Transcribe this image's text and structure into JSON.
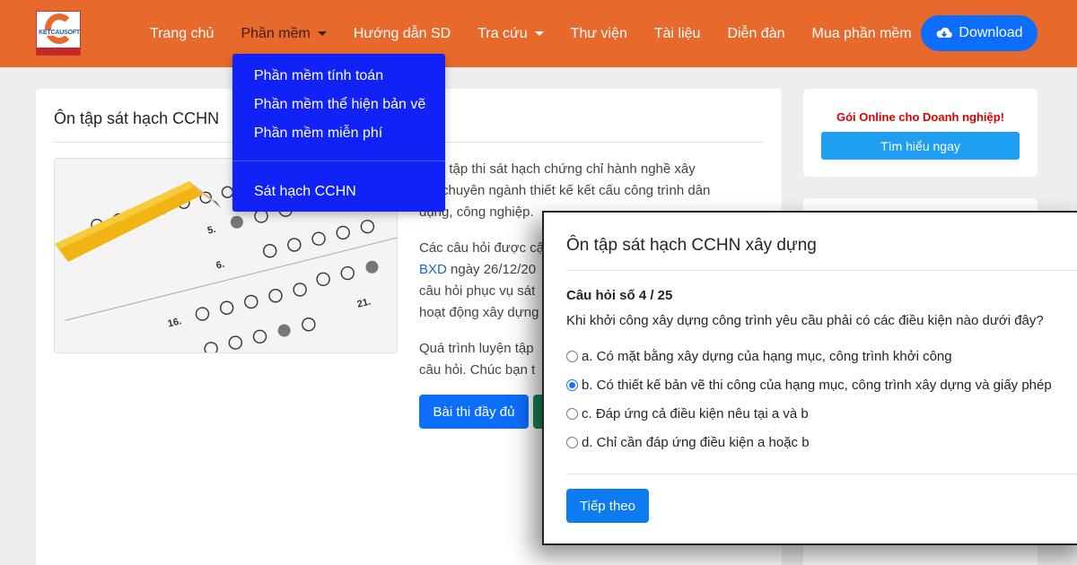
{
  "navbar": {
    "logo_text": "KETCAUSOFT",
    "items": [
      {
        "label": "Trang chủ"
      },
      {
        "label": "Phần mềm"
      },
      {
        "label": "Hướng dẫn SD"
      },
      {
        "label": "Tra cứu"
      },
      {
        "label": "Thư viện"
      },
      {
        "label": "Tài liệu"
      },
      {
        "label": "Diễn đàn"
      },
      {
        "label": "Mua phần mềm"
      }
    ],
    "download_label": "Download"
  },
  "dropdown": {
    "items": [
      {
        "label": "Phần mềm tính toán"
      },
      {
        "label": "Phần mềm thể hiện bản vẽ"
      },
      {
        "label": "Phần mềm miễn phí"
      },
      {
        "label": "Sát hạch CCHN"
      }
    ]
  },
  "main": {
    "title": "Ôn tập sát hạch CCHN",
    "para1": "g ôn tập thi sát hạch chứng chỉ hành nghề xây\nng, chuyên ngành thiết kế kết cấu công trình dân\ndụng, công nghiệp.",
    "para2_pre": "Các câu hỏi được cậ",
    "para2_link": "BXD",
    "para2_post": " ngày 26/12/20",
    "para2_rest": "câu hỏi phục vụ sát\nhoạt động xây dựng",
    "para3": "Quá trình luyện tập\ncâu hỏi. Chúc bạn t",
    "btn_full": "Bài thi đầy đủ"
  },
  "sidebar": {
    "promo_text": "Gói Online cho Doanh nghiệp!",
    "promo_button": "Tìm hiểu ngay"
  },
  "modal": {
    "title": "Ôn tập sát hạch CCHN xây dựng",
    "question_no": "Câu hỏi số 4 / 25",
    "question": "Khi khởi công xây dựng công trình yêu cầu phải có các điều kiện nào dưới đây?",
    "options": [
      {
        "label": "a. Có mặt bằng xây dựng của hạng mục, công trình khởi công",
        "checked": false
      },
      {
        "label": "b. Có thiết kế bản vẽ thi công của hạng mục, công trình xây dựng và giấy phép",
        "checked": true
      },
      {
        "label": "c. Đáp ứng cả điều kiện nêu tại a và b",
        "checked": false
      },
      {
        "label": "d. Chỉ cần đáp ứng điều kiện a hoặc b",
        "checked": false
      }
    ],
    "next_label": "Tiếp theo"
  },
  "colors": {
    "navbar_bg": "#e8692c",
    "dropdown_bg": "#1022f5",
    "primary": "#0d6efd",
    "promo_red": "#e10000",
    "promo_button": "#1e9ff2",
    "success": "#198754"
  }
}
